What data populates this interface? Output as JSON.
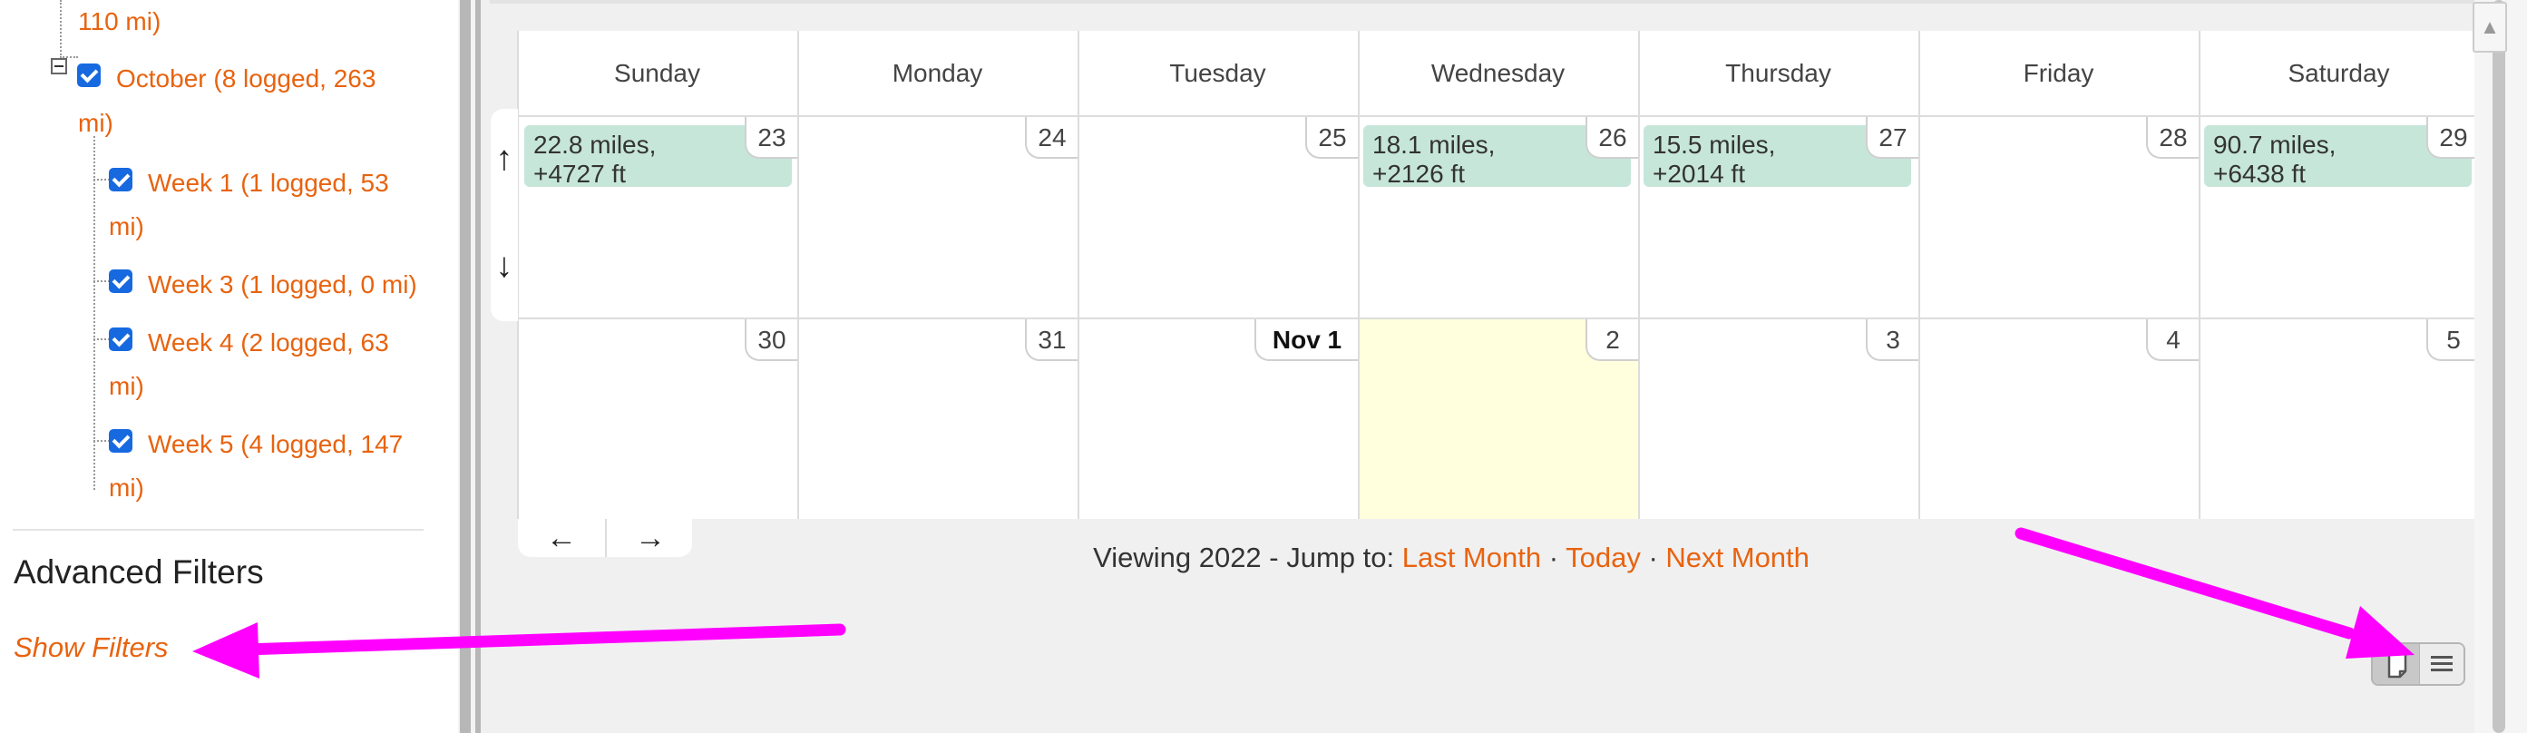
{
  "sidebar": {
    "tree": {
      "item_110": "110 mi)",
      "october_line1": "October (8 logged, 263",
      "october_line2": "mi)",
      "week1_line1": "Week 1 (1 logged, 53",
      "week1_line2": "mi)",
      "week3": "Week 3 (1 logged, 0 mi)",
      "week4_line1": "Week 4 (2 logged, 63",
      "week4_line2": "mi)",
      "week5_line1": "Week 5 (4 logged, 147",
      "week5_line2": "mi)"
    },
    "advanced_filters_title": "Advanced Filters",
    "show_filters_label": "Show Filters"
  },
  "calendar": {
    "days": [
      "Sunday",
      "Monday",
      "Tuesday",
      "Wednesday",
      "Thursday",
      "Friday",
      "Saturday"
    ],
    "week1_dates": [
      "23",
      "24",
      "25",
      "26",
      "27",
      "28",
      "29"
    ],
    "week2_dates": [
      "30",
      "31",
      "Nov 1",
      "2",
      "3",
      "4",
      "5"
    ],
    "events": [
      {
        "day": "Sunday",
        "line1": "22.8 miles,",
        "line2": "+4727 ft"
      },
      {
        "day": "Wednesday",
        "line1": "18.1 miles,",
        "line2": "+2126 ft"
      },
      {
        "day": "Thursday",
        "line1": "15.5 miles,",
        "line2": "+2014 ft"
      },
      {
        "day": "Saturday",
        "line1": "90.7 miles,",
        "line2": "+6438 ft"
      }
    ],
    "today_highlight_color": "#ffffdd",
    "event_color": "#c6e6d9"
  },
  "navigation": {
    "week_up": "↑",
    "week_down": "↓",
    "month_prev": "←",
    "month_next": "→",
    "viewing_prefix": "Viewing 2022 - Jump to: ",
    "last_month": "Last Month",
    "today": "Today",
    "next_month": "Next Month",
    "separator": " · "
  },
  "scrollbar": {
    "up_arrow": "▲"
  },
  "colors": {
    "accent": "#e8630f",
    "annotation_arrow": "#ff00ff"
  }
}
